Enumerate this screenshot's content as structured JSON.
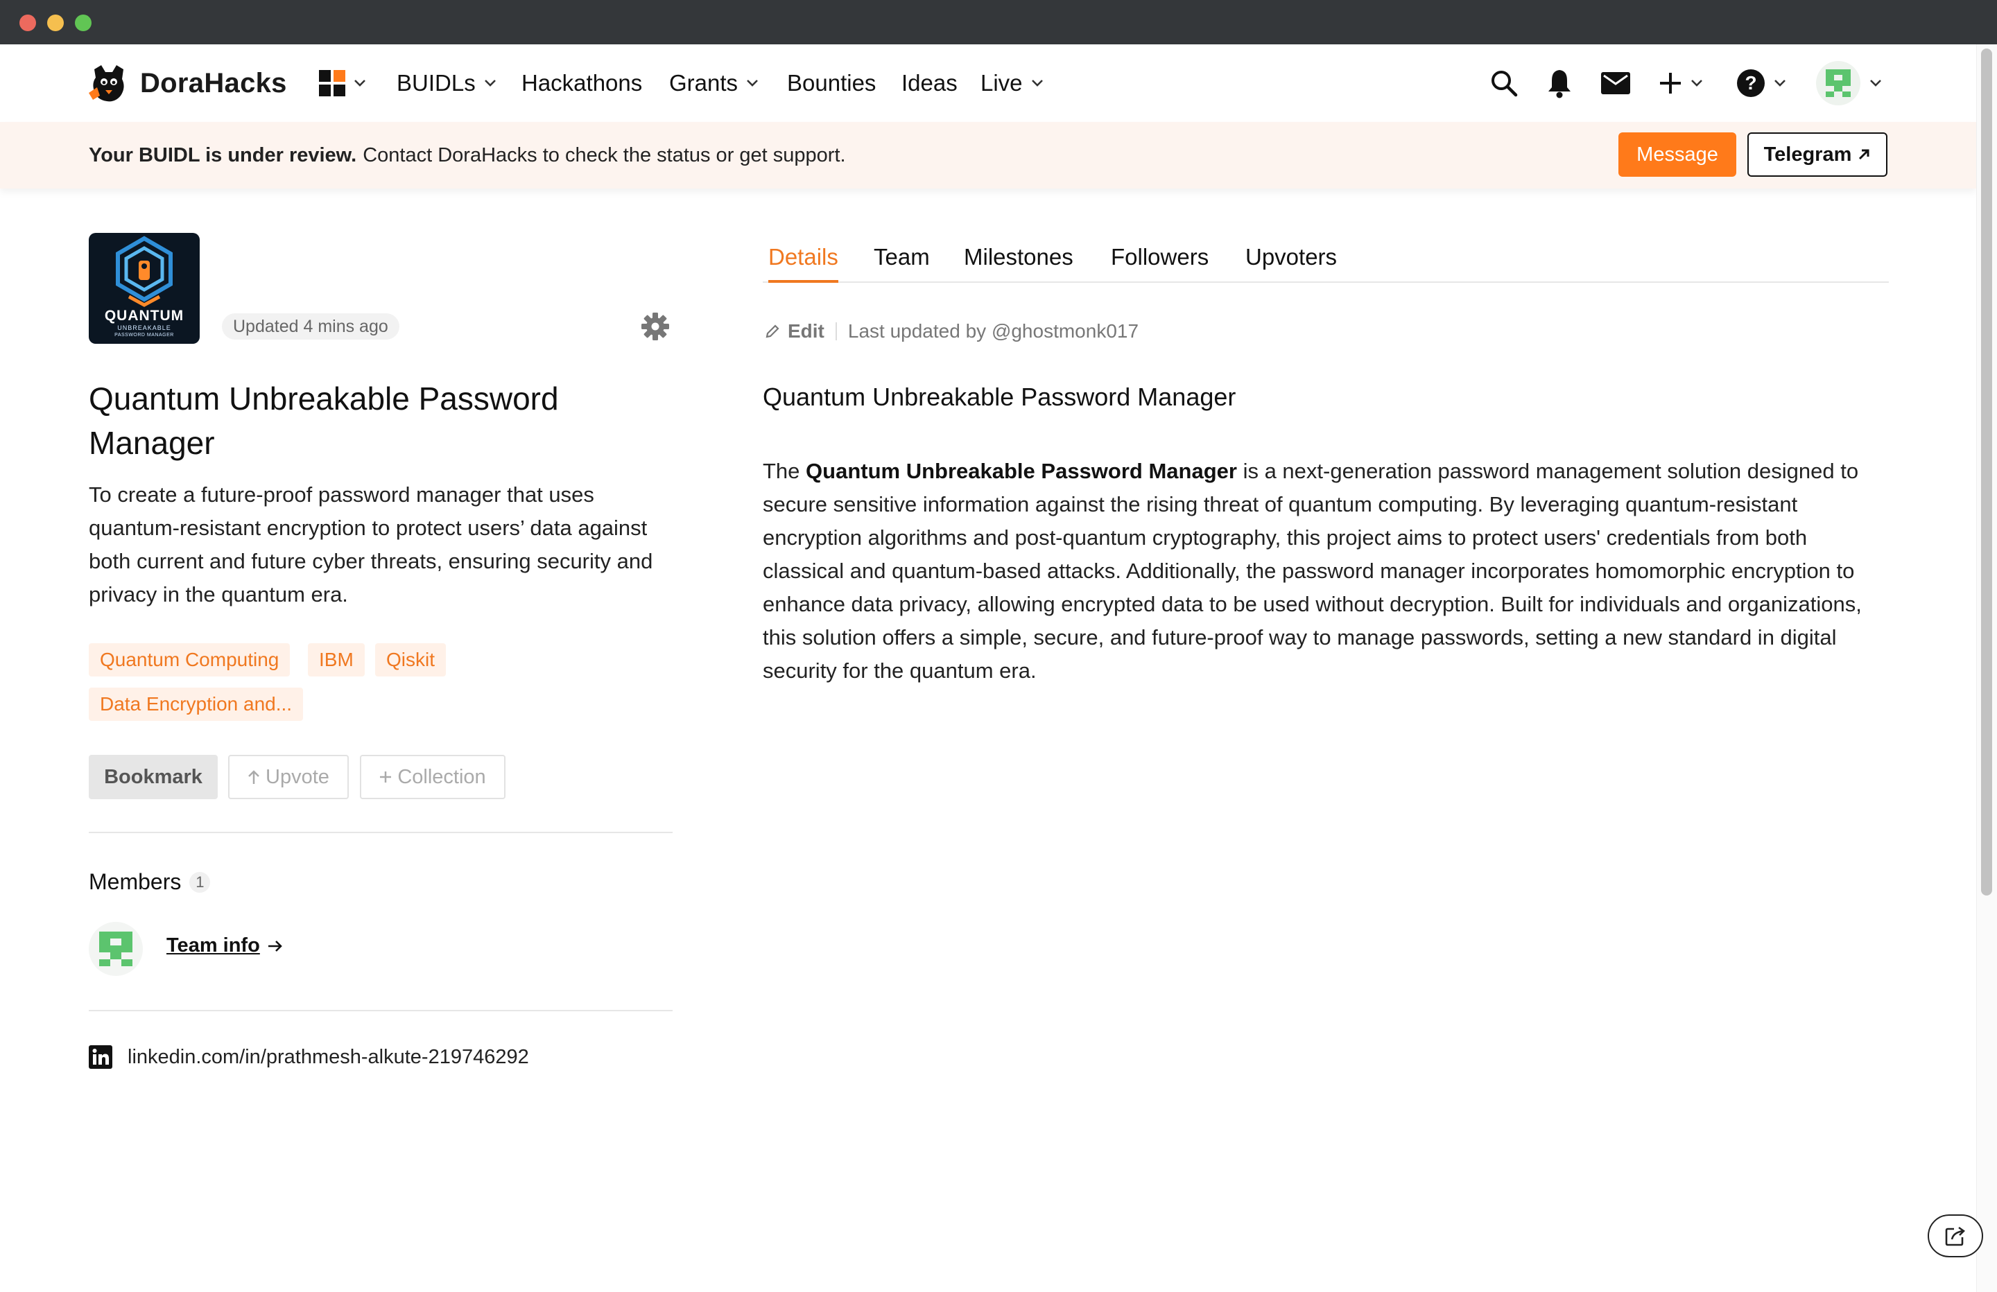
{
  "nav": {
    "brand": "DoraHacks",
    "items": [
      {
        "label": "BUIDLs",
        "has_dropdown": true
      },
      {
        "label": "Hackathons",
        "has_dropdown": false
      },
      {
        "label": "Grants",
        "has_dropdown": true
      },
      {
        "label": "Bounties",
        "has_dropdown": false
      },
      {
        "label": "Ideas",
        "has_dropdown": false
      },
      {
        "label": "Live",
        "has_dropdown": true
      }
    ],
    "icons": [
      "apps-grid-icon",
      "search-icon",
      "bell-icon",
      "mail-icon",
      "plus-icon",
      "help-icon",
      "avatar"
    ]
  },
  "banner": {
    "bold": "Your BUIDL is under review.",
    "text": "Contact DoraHacks to check the status or get support.",
    "message_label": "Message",
    "telegram_label": "Telegram"
  },
  "project": {
    "logo_word": "QUANTUM",
    "logo_sub1": "UNBREAKABLE",
    "logo_sub2": "PASSWORD MANAGER",
    "updated": "Updated 4 mins ago",
    "title": "Quantum Unbreakable Password Manager",
    "description": "To create a future-proof password manager that uses quantum-resistant encryption to protect users’ data against both current and future cyber threats, ensuring security and privacy in the quantum era.",
    "tags": [
      "Quantum Computing",
      "IBM",
      "Qiskit",
      "Data Encryption and..."
    ],
    "actions": {
      "bookmark": "Bookmark",
      "upvote": "Upvote",
      "collection": "Collection"
    },
    "members_label": "Members",
    "members_count": "1",
    "team_info": "Team info",
    "linkedin": "linkedin.com/in/prathmesh-alkute-219746292"
  },
  "tabs": [
    "Details",
    "Team",
    "Milestones",
    "Followers",
    "Upvoters"
  ],
  "active_tab": "Details",
  "details": {
    "edit_label": "Edit",
    "last_updated": "Last updated by @ghostmonk017",
    "heading": "Quantum Unbreakable Password Manager",
    "body_intro": "The",
    "body_bold": "Quantum Unbreakable Password Manager",
    "body_rest": "is a next-generation password management solution designed to secure sensitive information against the rising threat of quantum computing. By leveraging quantum-resistant encryption algorithms and post-quantum cryptography, this project aims to protect users' credentials from both classical and quantum-based attacks. Additionally, the password manager incorporates homomorphic encryption to enhance data privacy, allowing encrypted data to be used without decryption. Built for individuals and organizations, this solution offers a simple, secure, and future-proof way to manage passwords, setting a new standard in digital security for the quantum era."
  },
  "colors": {
    "accent": "#f07820",
    "button_orange": "#ff7a1a",
    "banner_bg": "#fdf4ef",
    "tag_bg": "#fff1e8",
    "avatar_green": "#5cc46e"
  }
}
